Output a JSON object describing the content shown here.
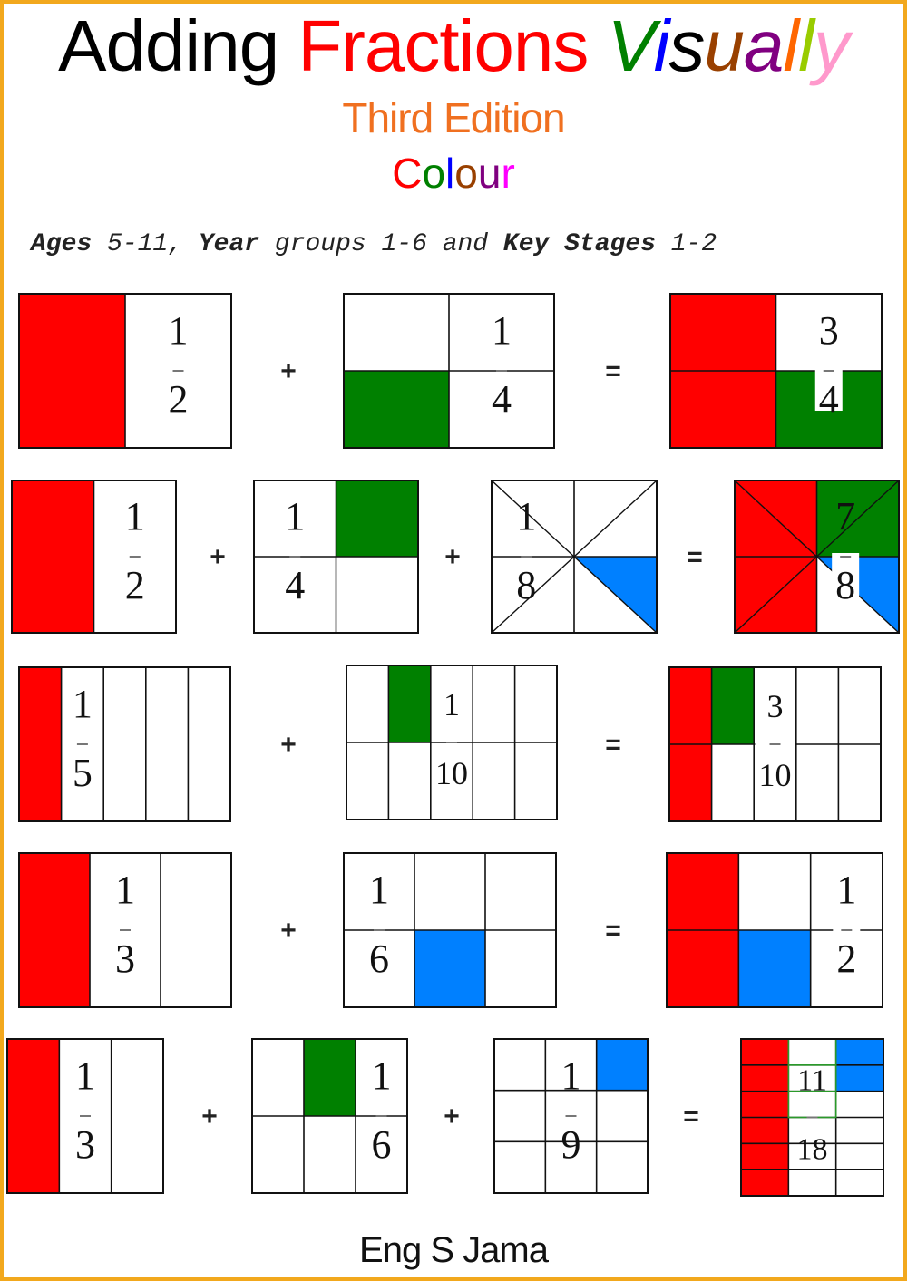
{
  "cover": {
    "title_words": [
      {
        "text": "Adding",
        "color": "#000000",
        "italic": false,
        "letters": null
      },
      {
        "text": "Fractions",
        "color": "#ff0000",
        "italic": false,
        "letters": null
      },
      {
        "text": "Visually",
        "color": null,
        "italic": true,
        "letters": [
          {
            "ch": "V",
            "color": "#008000"
          },
          {
            "ch": "i",
            "color": "#0000ff"
          },
          {
            "ch": "s",
            "color": "#000000"
          },
          {
            "ch": "u",
            "color": "#994000"
          },
          {
            "ch": "a",
            "color": "#800080"
          },
          {
            "ch": "l",
            "color": "#ff6600"
          },
          {
            "ch": "l",
            "color": "#99cc00"
          },
          {
            "ch": "y",
            "color": "#ff99cc"
          }
        ]
      }
    ],
    "edition": {
      "text": "Third Edition",
      "color": "#f07020"
    },
    "colour_word": [
      {
        "ch": "C",
        "color": "#ff0000"
      },
      {
        "ch": "o",
        "color": "#008000"
      },
      {
        "ch": "l",
        "color": "#0000ff"
      },
      {
        "ch": "o",
        "color": "#994000"
      },
      {
        "ch": "u",
        "color": "#800080"
      },
      {
        "ch": "r",
        "color": "#ff00ff"
      }
    ],
    "audience": [
      {
        "text": "Ages",
        "bold": true
      },
      {
        "text": " 5-11, ",
        "bold": false
      },
      {
        "text": "Year",
        "bold": true
      },
      {
        "text": " groups 1-6 and ",
        "bold": false
      },
      {
        "text": "Key Stages",
        "bold": true
      },
      {
        "text": " 1-2",
        "bold": false
      }
    ],
    "author": "Eng S Jama",
    "border_color": "#f2a81d"
  },
  "colors": {
    "red": "#ff0000",
    "green": "#008000",
    "blue": "#0080ff",
    "line": "#111111",
    "green_line": "#2a9a2a"
  },
  "equations": [
    {
      "name": "half-plus-quarter",
      "operators": [
        "+",
        "="
      ],
      "terms": [
        {
          "numerator": "1",
          "denominator": "2",
          "cols": 2,
          "rows": 1,
          "filled": [
            {
              "c": 0,
              "r": 0,
              "color": "red"
            }
          ]
        },
        {
          "numerator": "1",
          "denominator": "4",
          "cols": 2,
          "rows": 2,
          "filled": [
            {
              "c": 0,
              "r": 1,
              "color": "green"
            }
          ]
        },
        {
          "numerator": "3",
          "denominator": "4",
          "cols": 2,
          "rows": 2,
          "filled": [
            {
              "c": 0,
              "r": 0,
              "color": "red"
            },
            {
              "c": 0,
              "r": 1,
              "color": "red"
            },
            {
              "c": 1,
              "r": 1,
              "color": "green"
            }
          ],
          "result": true
        }
      ]
    },
    {
      "name": "half-plus-quarter-plus-eighth",
      "operators": [
        "+",
        "+",
        "="
      ],
      "terms": [
        {
          "numerator": "1",
          "denominator": "2",
          "cols": 2,
          "rows": 1,
          "filled": [
            {
              "c": 0,
              "r": 0,
              "color": "red"
            }
          ]
        },
        {
          "numerator": "1",
          "denominator": "4",
          "cols": 2,
          "rows": 2,
          "filled": [
            {
              "c": 1,
              "r": 0,
              "color": "green"
            }
          ]
        },
        {
          "numerator": "1",
          "denominator": "8",
          "cols": 2,
          "rows": 2,
          "diagonals": true,
          "filled_triangles": [
            {
              "tri": 5,
              "color": "blue"
            }
          ]
        },
        {
          "numerator": "7",
          "denominator": "8",
          "cols": 2,
          "rows": 2,
          "diagonals": true,
          "filled": [
            {
              "c": 0,
              "r": 0,
              "color": "red"
            },
            {
              "c": 0,
              "r": 1,
              "color": "red"
            },
            {
              "c": 1,
              "r": 0,
              "color": "green"
            }
          ],
          "filled_triangles": [
            {
              "tri": 5,
              "color": "blue"
            }
          ],
          "result": true
        }
      ]
    },
    {
      "name": "fifth-plus-tenth",
      "operators": [
        "+",
        "="
      ],
      "terms": [
        {
          "numerator": "1",
          "denominator": "5",
          "cols": 5,
          "rows": 1,
          "filled": [
            {
              "c": 0,
              "r": 0,
              "color": "red"
            }
          ]
        },
        {
          "numerator": "1",
          "denominator": "10",
          "cols": 5,
          "rows": 2,
          "filled": [
            {
              "c": 1,
              "r": 0,
              "color": "green"
            }
          ]
        },
        {
          "numerator": "3",
          "denominator": "10",
          "cols": 5,
          "rows": 2,
          "filled": [
            {
              "c": 0,
              "r": 0,
              "color": "red"
            },
            {
              "c": 0,
              "r": 1,
              "color": "red"
            },
            {
              "c": 1,
              "r": 0,
              "color": "green"
            }
          ],
          "result": true
        }
      ]
    },
    {
      "name": "third-plus-sixth",
      "operators": [
        "+",
        "="
      ],
      "terms": [
        {
          "numerator": "1",
          "denominator": "3",
          "cols": 3,
          "rows": 1,
          "filled": [
            {
              "c": 0,
              "r": 0,
              "color": "red"
            }
          ]
        },
        {
          "numerator": "1",
          "denominator": "6",
          "cols": 3,
          "rows": 2,
          "filled": [
            {
              "c": 1,
              "r": 1,
              "color": "blue"
            }
          ]
        },
        {
          "numerator": "1",
          "denominator": "2",
          "cols": 3,
          "rows": 2,
          "filled": [
            {
              "c": 0,
              "r": 0,
              "color": "red"
            },
            {
              "c": 0,
              "r": 1,
              "color": "red"
            },
            {
              "c": 1,
              "r": 1,
              "color": "blue"
            }
          ],
          "result": true
        }
      ]
    },
    {
      "name": "third-plus-sixth-plus-ninth",
      "operators": [
        "+",
        "+",
        "="
      ],
      "terms": [
        {
          "numerator": "1",
          "denominator": "3",
          "cols": 3,
          "rows": 1,
          "filled": [
            {
              "c": 0,
              "r": 0,
              "color": "red"
            }
          ]
        },
        {
          "numerator": "1",
          "denominator": "6",
          "cols": 3,
          "rows": 2,
          "filled": [
            {
              "c": 1,
              "r": 0,
              "color": "green"
            }
          ]
        },
        {
          "numerator": "1",
          "denominator": "9",
          "cols": 3,
          "rows": 3,
          "filled": [
            {
              "c": 2,
              "r": 0,
              "color": "blue"
            }
          ]
        },
        {
          "numerator": "11",
          "denominator": "18",
          "cols": 3,
          "rows": 6,
          "filled": [
            {
              "c": 0,
              "r": 0,
              "color": "red"
            },
            {
              "c": 0,
              "r": 1,
              "color": "red"
            },
            {
              "c": 0,
              "r": 2,
              "color": "red"
            },
            {
              "c": 0,
              "r": 3,
              "color": "red"
            },
            {
              "c": 0,
              "r": 4,
              "color": "red"
            },
            {
              "c": 0,
              "r": 5,
              "color": "red"
            },
            {
              "c": 2,
              "r": 0,
              "color": "blue"
            },
            {
              "c": 2,
              "r": 1,
              "color": "blue"
            }
          ],
          "green_outline": {
            "c": 1,
            "r0": 0,
            "r1": 2
          },
          "result": true
        }
      ]
    }
  ]
}
